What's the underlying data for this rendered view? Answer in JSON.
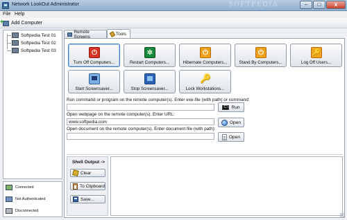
{
  "window": {
    "title": "Network LookOut Administrator",
    "watermark": "SOFTPEDIA",
    "controls": {
      "minimize": "–",
      "maximize": "□",
      "close": "x"
    }
  },
  "menu": [
    {
      "label": "File"
    },
    {
      "label": "Help"
    }
  ],
  "toolbar": {
    "add_computer": "Add Computer"
  },
  "computers": [
    {
      "label": "Softpedia Test 01"
    },
    {
      "label": "Softpedia Test 02"
    },
    {
      "label": "Softpedia Test 03"
    }
  ],
  "legend": [
    {
      "label": "Connected",
      "color": "#7fb06c"
    },
    {
      "label": "Not Authenticated",
      "color": "#6f92c1"
    },
    {
      "label": "Disconnected",
      "color": "#b7b7b7"
    }
  ],
  "tabs": [
    {
      "label": "Remote Screens",
      "active": false
    },
    {
      "label": "Tools",
      "active": true
    }
  ],
  "actions": [
    {
      "label": "Turn Off Computers...",
      "icon": "power-icon",
      "glyph": "⏻"
    },
    {
      "label": "Restart Computers...",
      "icon": "restart-icon",
      "glyph": "✲"
    },
    {
      "label": "Hibernate Computers...",
      "icon": "hibernate-icon",
      "glyph": "⏻"
    },
    {
      "label": "Stand By Computers...",
      "icon": "standby-icon",
      "glyph": "⏻"
    },
    {
      "label": "Log Off Users...",
      "icon": "logoff-icon",
      "glyph": "🔑"
    },
    {
      "label": "Start Screensaver...",
      "icon": "screensaver-icon",
      "glyph": ""
    },
    {
      "label": "Stop Screensaver...",
      "icon": "monitor-icon",
      "glyph": ""
    },
    {
      "label": "Lock Workstations...",
      "icon": "key-icon",
      "glyph": "🔑"
    }
  ],
  "run": {
    "label": "Run command or program on the remote computer(s). Enter exe-file (with path) or command:",
    "value": "",
    "button": "Run"
  },
  "webpage": {
    "label": "Open webpage on the remote computer(s). Enter URL:",
    "value": "www.softpedia.com",
    "button": "Open"
  },
  "document": {
    "label": "Open document on the remote computer(s). Enter document file (with path):",
    "value": "",
    "button": "Open"
  },
  "shell": {
    "title": "Shell Output ->",
    "clear": "Clear",
    "clipboard": "To Clipboard",
    "save": "Save..."
  },
  "colors": {
    "titlebar": "#9db9d6",
    "selected_border": "#3d7bbd"
  }
}
